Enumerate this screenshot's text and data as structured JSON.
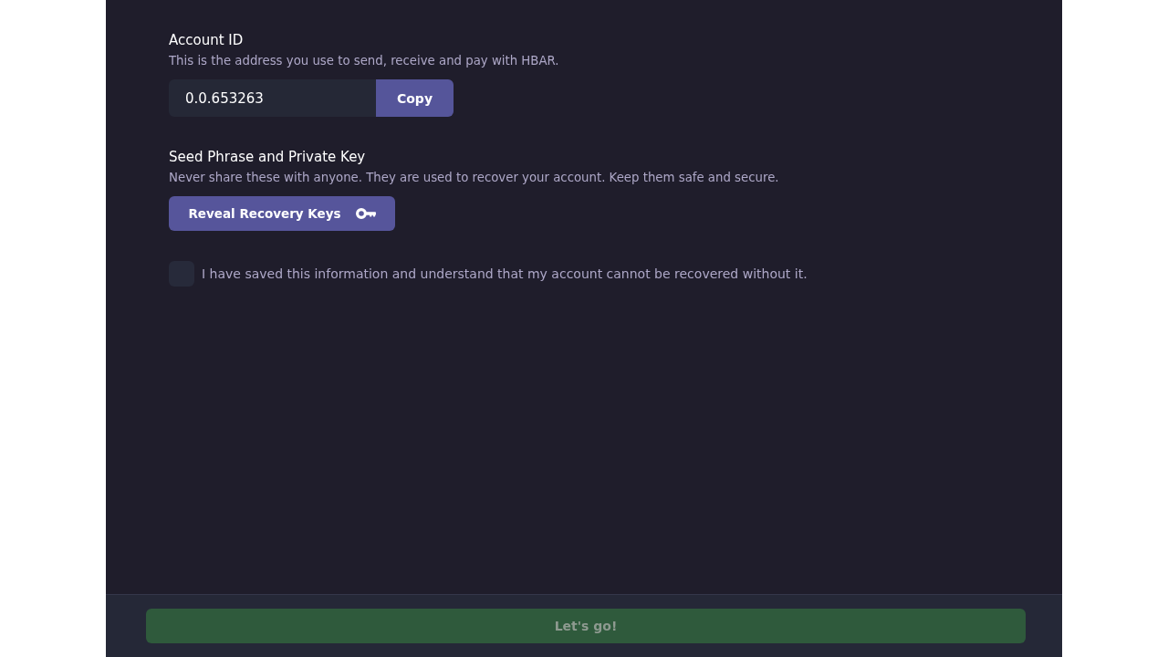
{
  "account": {
    "title": "Account ID",
    "description": "This is the address you use to send, receive and pay with HBAR.",
    "value": "0.0.653263",
    "copy_button": "Copy"
  },
  "recovery": {
    "title": "Seed Phrase and Private Key",
    "description": "Never share these with anyone. They are used to recover your account. Keep them safe and secure.",
    "reveal_button": "Reveal Recovery Keys"
  },
  "confirmation": {
    "label": "I have saved this information and understand that my account cannot be recovered without it.",
    "checked": false
  },
  "footer": {
    "button": {
      "label": "Let's go!",
      "disabled": true
    }
  }
}
